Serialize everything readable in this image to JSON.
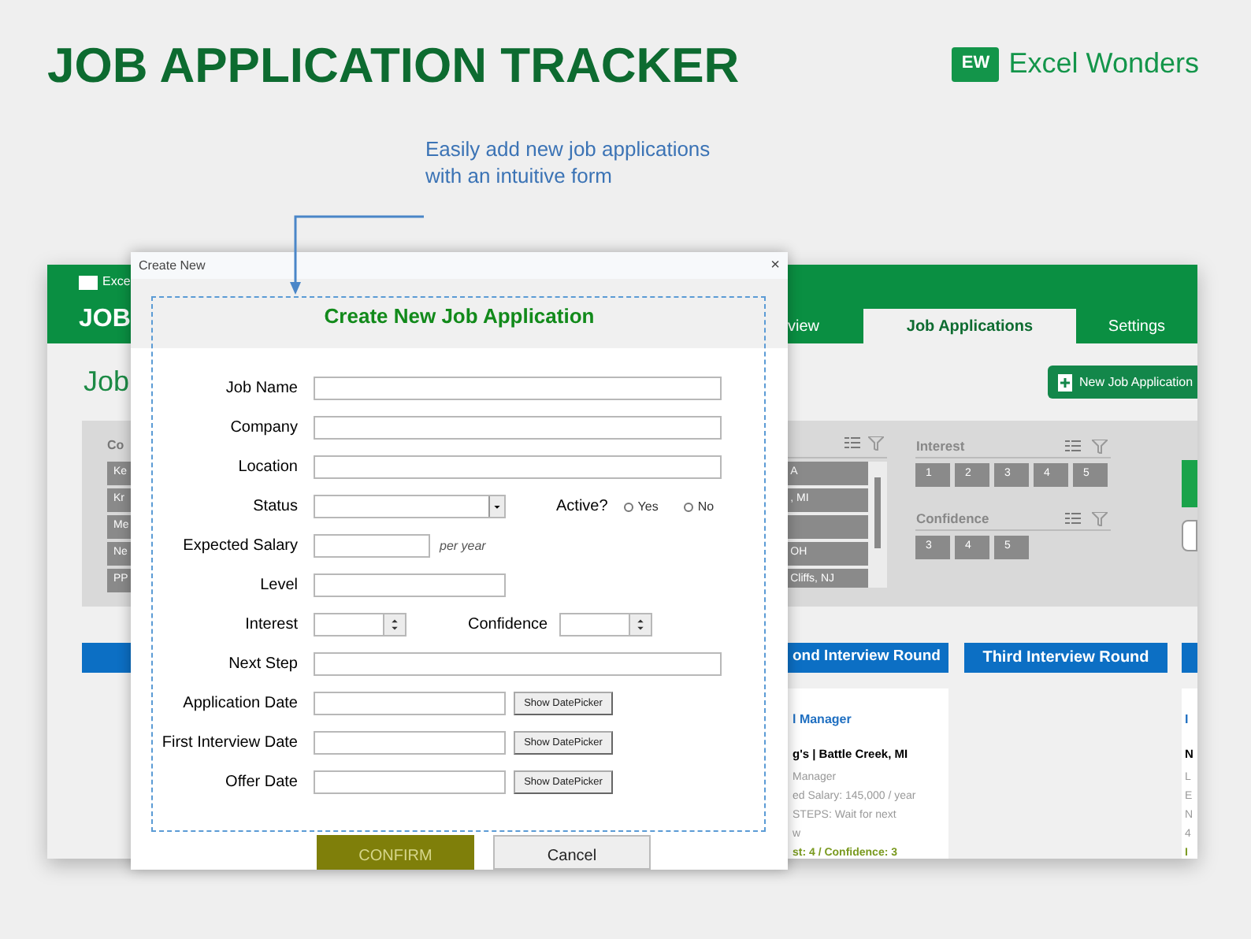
{
  "page_title": "JOB APPLICATION TRACKER",
  "brand": {
    "mark": "EW",
    "name": "Excel Wonders"
  },
  "callout": {
    "lines": [
      "Easily add new job applications",
      "with an intuitive form"
    ]
  },
  "app": {
    "logo": "Exce",
    "header_title": "JOB",
    "tabs": [
      {
        "label": "view",
        "selected": false
      },
      {
        "label": "Job Applications",
        "selected": true
      },
      {
        "label": "Settings",
        "selected": false
      }
    ],
    "page_heading": "Job",
    "new_button": "New Job Application",
    "company_slicer": {
      "label": "Co",
      "items": [
        "Ke",
        "Kr",
        "Me",
        "Ne",
        "PP"
      ]
    },
    "location_slicer": {
      "items": [
        {
          "kind": "text",
          "label": "A"
        },
        {
          "kind": "text",
          "label": ", MI"
        },
        {
          "kind": "blank"
        },
        {
          "kind": "text",
          "label": "OH"
        },
        {
          "kind": "text",
          "label": "Cliffs, NJ"
        }
      ]
    },
    "interest": {
      "label": "Interest",
      "items": [
        "1",
        "2",
        "3",
        "4",
        "5"
      ]
    },
    "confidence": {
      "label": "Confidence",
      "items": [
        "3",
        "4",
        "5"
      ]
    },
    "columns": [
      "ond Interview Round",
      "Third Interview Round"
    ],
    "cards": [
      {
        "title": "l Manager",
        "company": "g's | Battle Creek, MI",
        "lines": [
          "Manager",
          "ed Salary: 145,000 / year",
          "STEPS: Wait for next",
          "w"
        ],
        "rating": "st: 4 / Confidence: 3"
      },
      {
        "title": "I",
        "company": "N",
        "lines": [
          "L",
          "E",
          "N",
          "4"
        ],
        "rating": "I"
      }
    ]
  },
  "dialog": {
    "window_title": "Create New",
    "close": "×",
    "title": "Create New Job Application",
    "fields": [
      {
        "kind": "long",
        "label": "Job Name"
      },
      {
        "kind": "long",
        "label": "Company"
      },
      {
        "kind": "long",
        "label": "Location"
      },
      {
        "kind": "status",
        "label": "Status",
        "active_label": "Active?",
        "options": [
          {
            "label": "Yes",
            "selected": false
          },
          {
            "label": "No",
            "selected": false
          }
        ]
      },
      {
        "kind": "salary",
        "label": "Expected Salary",
        "suffix": "per year"
      },
      {
        "kind": "short",
        "label": "Level"
      },
      {
        "kind": "spinners",
        "label": "Interest",
        "second_label": "Confidence"
      },
      {
        "kind": "long",
        "label": "Next Step"
      },
      {
        "kind": "date",
        "label": "Application Date",
        "button": "Show DatePicker"
      },
      {
        "kind": "date",
        "label": "First Interview Date",
        "button": "Show DatePicker"
      },
      {
        "kind": "date",
        "label": "Offer Date",
        "button": "Show DatePicker"
      }
    ],
    "buttons": [
      {
        "label": "CONFIRM",
        "kind": "primary"
      },
      {
        "label": "Cancel",
        "kind": "secondary"
      }
    ]
  }
}
